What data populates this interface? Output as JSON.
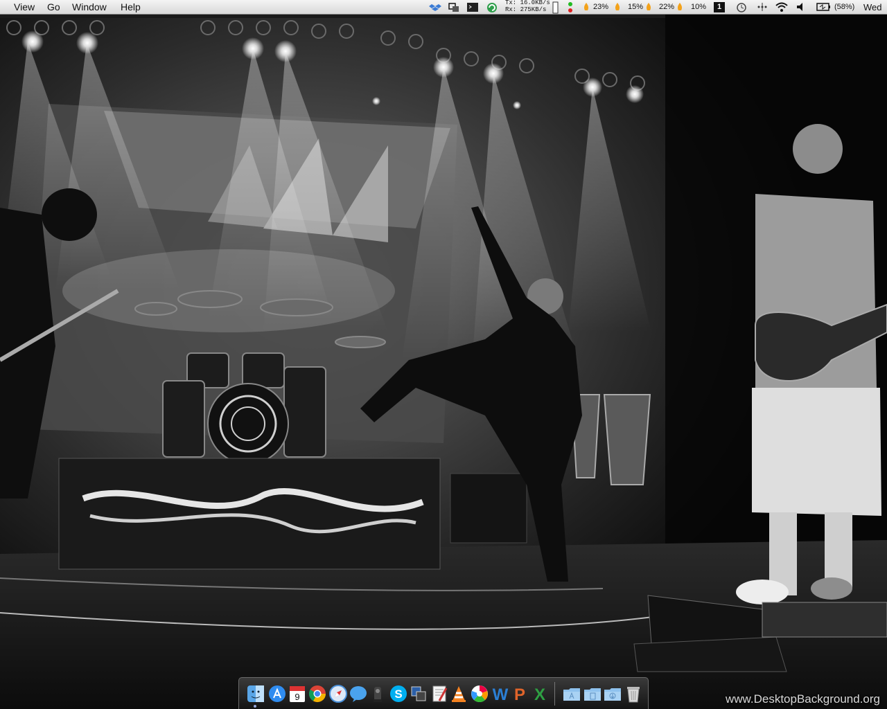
{
  "menubar": {
    "items": [
      "View",
      "Go",
      "Window",
      "Help"
    ],
    "network": {
      "tx": "Tx:  16.0KB/s",
      "rx": "Rx:  275KB/s"
    },
    "cpu": [
      "23%",
      "15%",
      "22%",
      "10%"
    ],
    "calendar_day": "1",
    "battery": "(58%)",
    "clock": "Wed"
  },
  "dock": {
    "icons": [
      "finder-icon",
      "app-store-icon",
      "calendar-icon",
      "chrome-icon",
      "safari-icon",
      "messages-icon",
      "audio-icon",
      "skype-icon",
      "virtualbox-icon",
      "script-editor-icon",
      "vlc-icon",
      "picasa-icon",
      "word-icon",
      "powerpoint-icon",
      "excel-icon",
      "applications-folder-icon",
      "documents-folder-icon",
      "downloads-folder-icon",
      "trash-icon"
    ],
    "calendar_date": "9"
  },
  "watermark": "www.DesktopBackground.org",
  "colors": {
    "menubar_bg": "#e6e6e6",
    "dock_bg": "#222222"
  }
}
